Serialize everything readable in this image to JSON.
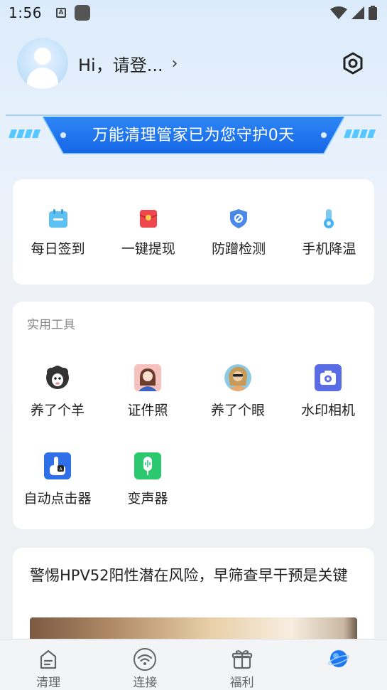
{
  "status_bar": {
    "time": "1:56",
    "keyboard_badge": "A"
  },
  "header": {
    "greeting": "Hi，请登...",
    "arrow": "›"
  },
  "banner": {
    "text": "万能清理管家已为您守护0天"
  },
  "quick_actions": [
    {
      "label": "每日签到",
      "icon": "calendar-icon"
    },
    {
      "label": "一键提现",
      "icon": "red-envelope-icon"
    },
    {
      "label": "防蹭检测",
      "icon": "shield-icon"
    },
    {
      "label": "手机降温",
      "icon": "thermometer-icon"
    }
  ],
  "tools": {
    "title": "实用工具",
    "items": [
      {
        "label": "养了个羊",
        "icon": "sheep-icon"
      },
      {
        "label": "证件照",
        "icon": "id-photo-icon"
      },
      {
        "label": "养了个眼",
        "icon": "portrait-icon"
      },
      {
        "label": "水印相机",
        "icon": "camera-icon"
      },
      {
        "label": "自动点击器",
        "icon": "auto-clicker-icon"
      },
      {
        "label": "变声器",
        "icon": "voice-changer-icon"
      }
    ]
  },
  "article": {
    "title": "警惕HPV52阳性潜在风险，早筛查早干预是关键"
  },
  "tabbar": {
    "tabs": [
      {
        "label": "清理",
        "icon": "broom-icon"
      },
      {
        "label": "连接",
        "icon": "wifi-icon"
      },
      {
        "label": "福利",
        "icon": "gift-icon"
      },
      {
        "label": "",
        "icon": "planet-icon"
      }
    ]
  },
  "colors": {
    "accent": "#1f6ff0",
    "banner": "#1f78f0",
    "background": "#eef0f4"
  }
}
